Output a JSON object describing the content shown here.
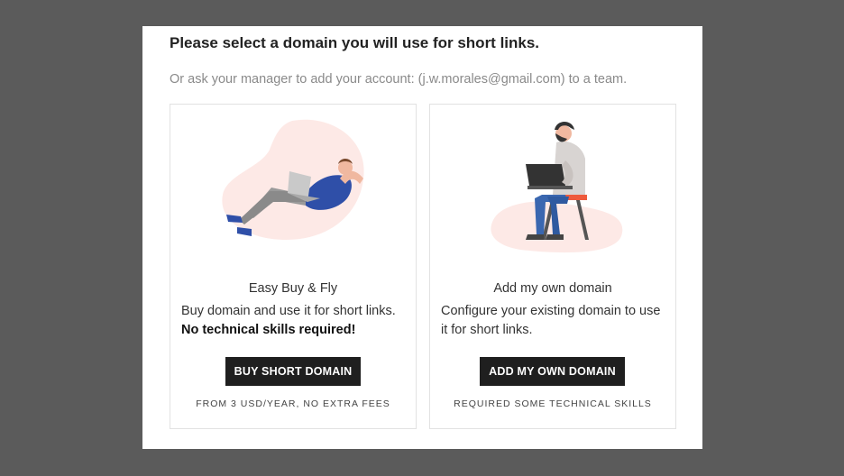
{
  "dialog": {
    "title": "Please select a domain you will use for short links.",
    "subtitle": "Or ask your manager to add your account: (j.w.morales@gmail.com) to a team."
  },
  "options": [
    {
      "heading": "Easy Buy & Fly",
      "description": "Buy domain and use it for short links.",
      "emphasis": "No technical skills required!",
      "button_label": "BUY SHORT DOMAIN",
      "note": "FROM 3 USD/YEAR, NO EXTRA FEES",
      "illustration": "person-relaxing-with-laptop-icon"
    },
    {
      "heading": "Add my own domain",
      "description": "Configure your existing domain to use it for short links.",
      "emphasis": "",
      "button_label": "ADD MY OWN DOMAIN",
      "note": "REQUIRED SOME TECHNICAL SKILLS",
      "illustration": "person-sitting-with-laptop-icon"
    }
  ],
  "colors": {
    "backdrop": "#5b5b5b",
    "button": "#1f1f1f",
    "blob": "#fde9e6",
    "accent_blue": "#2f4fa8",
    "accent_red": "#ee5a3c"
  }
}
